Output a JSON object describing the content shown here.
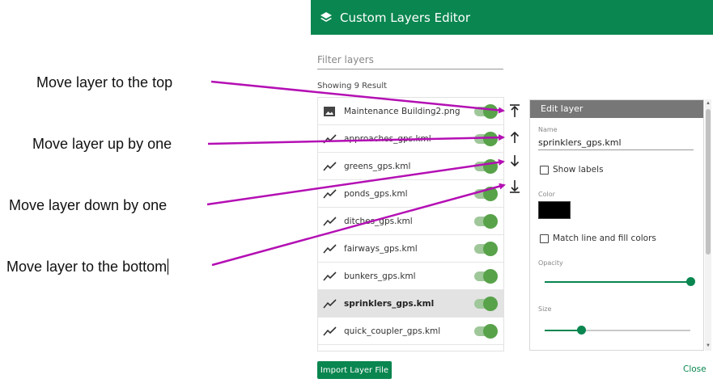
{
  "annotations": {
    "move_top": "Move layer to the top",
    "move_up": "Move layer up by one",
    "move_down": "Move layer down by one",
    "move_bottom": "Move layer to the bottom"
  },
  "dialog": {
    "title": "Custom Layers Editor",
    "title_icon": "layers-icon",
    "filter_placeholder": "Filter layers",
    "results_text": "Showing 9 Result",
    "layers": [
      {
        "name": "Maintenance Building2.png",
        "icon": "image-icon",
        "enabled": true,
        "selected": false
      },
      {
        "name": "approaches_gps.kml",
        "icon": "line-icon",
        "enabled": true,
        "selected": false
      },
      {
        "name": "greens_gps.kml",
        "icon": "line-icon",
        "enabled": true,
        "selected": false
      },
      {
        "name": "ponds_gps.kml",
        "icon": "line-icon",
        "enabled": true,
        "selected": false
      },
      {
        "name": "ditches_gps.kml",
        "icon": "line-icon",
        "enabled": true,
        "selected": false
      },
      {
        "name": "fairways_gps.kml",
        "icon": "line-icon",
        "enabled": true,
        "selected": false
      },
      {
        "name": "bunkers_gps.kml",
        "icon": "line-icon",
        "enabled": true,
        "selected": false
      },
      {
        "name": "sprinklers_gps.kml",
        "icon": "line-icon",
        "enabled": true,
        "selected": true
      },
      {
        "name": "quick_coupler_gps.kml",
        "icon": "line-icon",
        "enabled": true,
        "selected": false
      }
    ],
    "move_buttons": {
      "top": "move-to-top-icon",
      "up": "arrow-up-icon",
      "down": "arrow-down-icon",
      "bottom": "move-to-bottom-icon"
    },
    "edit_panel": {
      "header": "Edit layer",
      "name_label": "Name",
      "name_value": "sprinklers_gps.kml",
      "show_labels": "Show labels",
      "show_labels_checked": false,
      "color_label": "Color",
      "color_value": "#000000",
      "match_colors": "Match line and fill colors",
      "match_colors_checked": false,
      "opacity_label": "Opacity",
      "opacity_level": 1.0,
      "size_label": "Size",
      "size_level": 0.25
    },
    "import_button": "Import Layer File",
    "close_link": "Close"
  },
  "colors": {
    "brand_green": "#0a8650",
    "toggle_knob": "#58a24a",
    "toggle_track": "#9fc79a",
    "annotation_arrow": "#b40fb4",
    "selected_row": "#e3e3e3",
    "panel_header": "#777777"
  }
}
